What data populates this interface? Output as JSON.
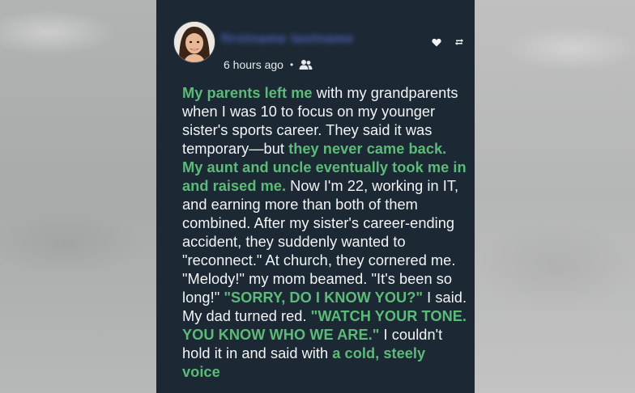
{
  "post": {
    "author_name": "firstname lastname",
    "timestamp": "6 hours ago",
    "separator": "•",
    "icons": {
      "audience": "friends-icon",
      "react": "heart-icon",
      "share": "repost-icon"
    },
    "colors": {
      "card_background": "#1c2833",
      "body_text": "#f2f4f6",
      "highlight_text": "#5cbb79"
    },
    "segments": [
      {
        "text": "My parents left me",
        "highlight": true
      },
      {
        "text": " with my grandparents when I was 10 to focus on my younger sister's sports career. They said it was temporary—but ",
        "highlight": false
      },
      {
        "text": "they never came back. My aunt and uncle eventually took me in and raised me.",
        "highlight": true
      },
      {
        "text": " Now I'm 22, working in IT, and earning more than both of them combined. After my sister's career-ending accident, they suddenly wanted to \"reconnect.\" At church, they cornered me. \"Melody!\" my mom beamed. \"It's been so long!\" ",
        "highlight": false
      },
      {
        "text": "\"SORRY, DO I KNOW YOU?\"",
        "highlight": true
      },
      {
        "text": " I said. My dad turned red. ",
        "highlight": false
      },
      {
        "text": "\"WATCH YOUR TONE. YOU KNOW WHO WE ARE.\"",
        "highlight": true
      },
      {
        "text": " I couldn't hold it in and said with ",
        "highlight": false
      },
      {
        "text": "a cold, steely voice",
        "highlight": true
      }
    ]
  }
}
